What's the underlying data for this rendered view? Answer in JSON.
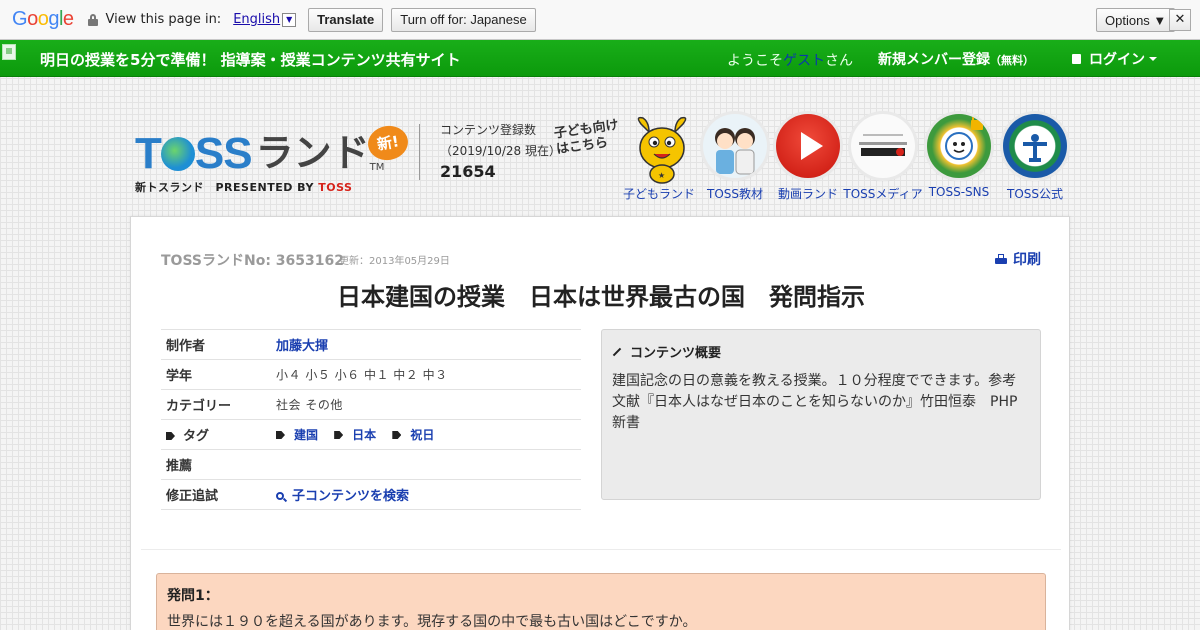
{
  "translate_bar": {
    "logo": "Google",
    "prompt": "View this page in:",
    "language": "English",
    "translate_button": "Translate",
    "turn_off_button": "Turn off for: Japanese",
    "options_button": "Options ▼",
    "close_symbol": "✕"
  },
  "header": {
    "site_title": "明日の授業を5分で準備！ 指導案・授業コンテンツ共有サイト",
    "welcome_prefix": "ようこそ",
    "guest": "ゲスト",
    "welcome_suffix": "さん",
    "signup": "新規メンバー登録",
    "signup_note": "（無料）",
    "login": "ログイン"
  },
  "logo": {
    "brand_t": "T",
    "brand_ss": "SS",
    "brand_land": "ランド",
    "tm": "TM",
    "new_badge": "新!",
    "sub_prefix": "新トスランド　PRESENTED BY ",
    "sub_brand": "TOSS"
  },
  "stats": {
    "label": "コンテンツ登録数",
    "date": "（2019/10/28 現在）",
    "count": "21654"
  },
  "kids_note": "子ども向け\nはこちら",
  "nav": [
    {
      "label": "子どもランド",
      "icon": "mascot-icon"
    },
    {
      "label": "TOSS教材",
      "icon": "students-icon"
    },
    {
      "label": "動画ランド",
      "icon": "play-icon"
    },
    {
      "label": "TOSSメディア",
      "icon": "media-icon"
    },
    {
      "label": "TOSS-SNS",
      "icon": "sns-icon"
    },
    {
      "label": "TOSS公式",
      "icon": "official-icon"
    }
  ],
  "content": {
    "number": "TOSSランドNo: 3653162",
    "updated": "更新：2013年05月29日",
    "print": "印刷",
    "title": "日本建国の授業　日本は世界最古の国　発問指示"
  },
  "meta": {
    "author_label": "制作者",
    "author": "加藤大揮",
    "grade_label": "学年",
    "grade": "小４ 小５ 小６ 中１ 中２ 中３",
    "category_label": "カテゴリー",
    "category": "社会 その他",
    "tag_label": "タグ",
    "tags": [
      "建国",
      "日本",
      "祝日"
    ],
    "recommend_label": "推薦",
    "revision_label": "修正追試",
    "child_search": "子コンテンツを検索"
  },
  "summary": {
    "heading": "コンテンツ概要",
    "body": "建国記念の日の意義を教える授業。１０分程度でできます。参考文献『日本人はなぜ日本のことを知らないのか』竹田恒泰　PHP新書"
  },
  "question": {
    "heading": "発問1：",
    "body": "世界には１９０を超える国があります。現存する国の中で最も古い国はどこですか。"
  },
  "colors": {
    "header_green": "#12a512",
    "link_blue": "#1a3fb0",
    "question_bg": "#fcd7c0",
    "summary_bg": "#ebebeb"
  }
}
